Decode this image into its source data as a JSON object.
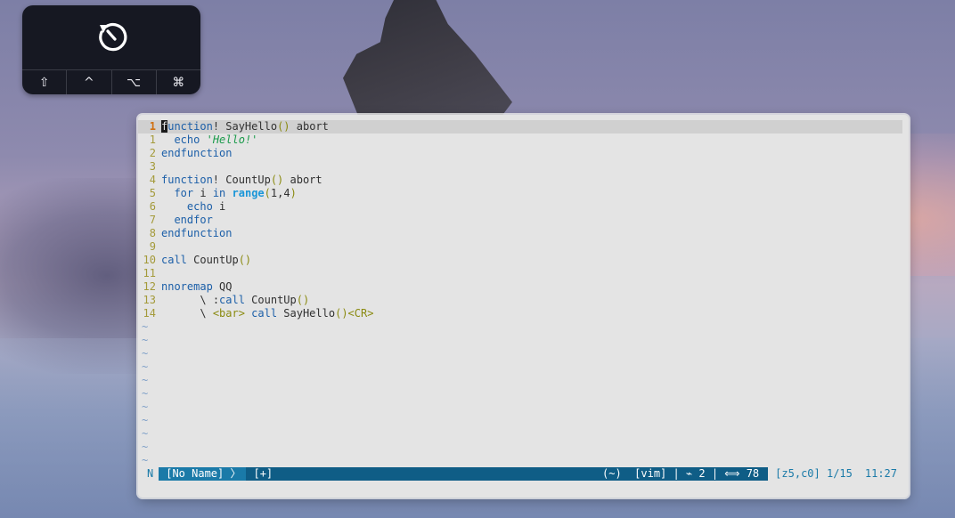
{
  "touchbar": {
    "keys": [
      "⇧",
      "^",
      "⌥",
      "⌘"
    ]
  },
  "editor": {
    "lines": [
      {
        "num": "1",
        "current": true
      },
      {
        "num": "1"
      },
      {
        "num": "2"
      },
      {
        "num": "3"
      },
      {
        "num": "4"
      },
      {
        "num": "5"
      },
      {
        "num": "6"
      },
      {
        "num": "7"
      },
      {
        "num": "8"
      },
      {
        "num": "9"
      },
      {
        "num": "10"
      },
      {
        "num": "11"
      },
      {
        "num": "12"
      },
      {
        "num": "13"
      },
      {
        "num": "14"
      }
    ],
    "code": {
      "l0": {
        "cursor_char": "f",
        "kw_rest": "unction",
        "bang_name": "! SayHello",
        "parens": "()",
        "tail": " abort"
      },
      "l1": {
        "indent": "  ",
        "kw": "echo",
        "str": "'Hello!'"
      },
      "l2": {
        "kw": "endfunction"
      },
      "l4": {
        "kw": "function",
        "bang_name": "! CountUp",
        "parens": "()",
        "tail": " abort"
      },
      "l5": {
        "indent": "  ",
        "kw_for": "for",
        "var": " i ",
        "kw_in": "in",
        "builtin": "range",
        "p_open": "(",
        "args": "1,4",
        "p_close": ")"
      },
      "l6": {
        "indent": "    ",
        "kw": "echo",
        "tail": " i"
      },
      "l7": {
        "indent": "  ",
        "kw": "endfor"
      },
      "l8": {
        "kw": "endfunction"
      },
      "l10": {
        "kw": "call",
        "name": " CountUp",
        "parens": "()"
      },
      "l12": {
        "kw": "nnoremap",
        "tail": " QQ"
      },
      "l13": {
        "indent": "      ",
        "bs": "\\ ",
        "colon": ":",
        "kw": "call",
        "name": " CountUp",
        "parens": "()"
      },
      "l14": {
        "indent": "      ",
        "bs": "\\ ",
        "bar": "<bar>",
        "kw": " call",
        "name": " SayHello",
        "parens": "()",
        "cr": "<CR>"
      }
    },
    "tilde_count": 11,
    "tilde_char": "~"
  },
  "statusline": {
    "mode": "N",
    "filename": "[No Name] 〉",
    "modified": "[+]",
    "right_info": "(~)  [vim] | ⌁ 2 | ⟺ 78",
    "position": "[z5,c0] 1/15",
    "time": "11:27"
  }
}
